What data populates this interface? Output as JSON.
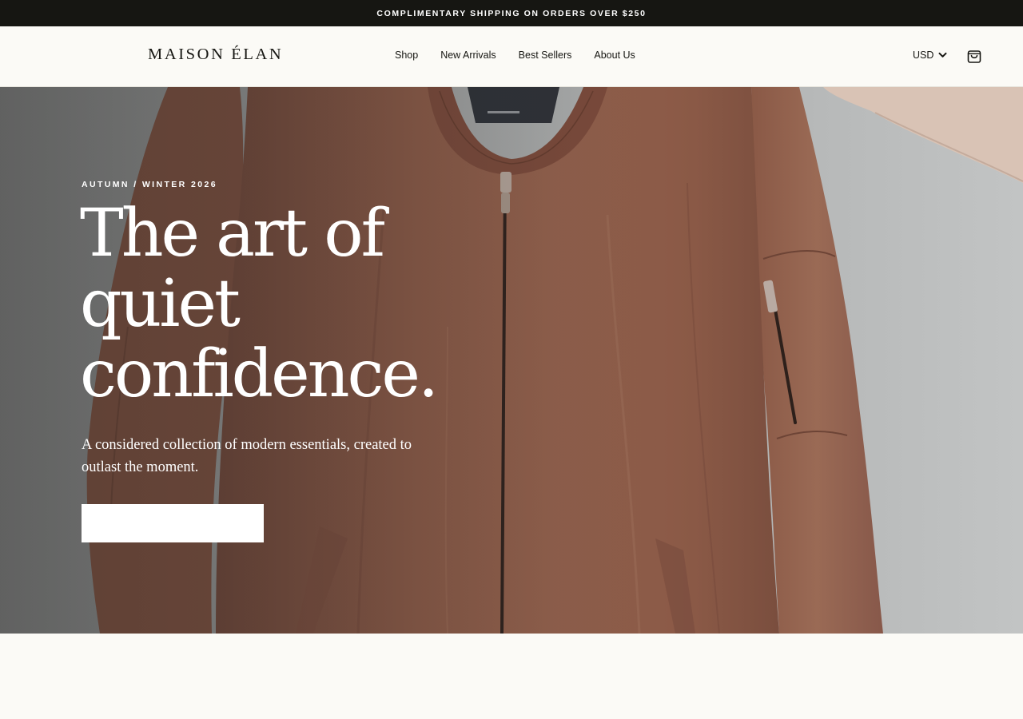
{
  "announcement": {
    "text": "COMPLIMENTARY SHIPPING ON ORDERS OVER $250"
  },
  "header": {
    "logo": "MAISON ÉLAN",
    "nav": [
      {
        "label": "Shop"
      },
      {
        "label": "New Arrivals"
      },
      {
        "label": "Best Sellers"
      },
      {
        "label": "About Us"
      }
    ],
    "currency": {
      "selected": "USD",
      "icon": "chevron-down-icon"
    },
    "cart_icon": "shopping-bag-icon"
  },
  "hero": {
    "eyebrow": "AUTUMN / WINTER 2026",
    "headline": "The art of quiet confidence.",
    "subtext": "A considered collection of modern essentials, created to outlast the moment.",
    "cta_label": "",
    "image": "rust-bomber-jacket-on-hanger"
  },
  "colors": {
    "announcement_bg": "#161612",
    "page_bg": "#fbfaf6",
    "jacket": "#8a5a48",
    "wall": "#b4b6b6",
    "text_dark": "#161612",
    "text_light": "#ffffff"
  }
}
